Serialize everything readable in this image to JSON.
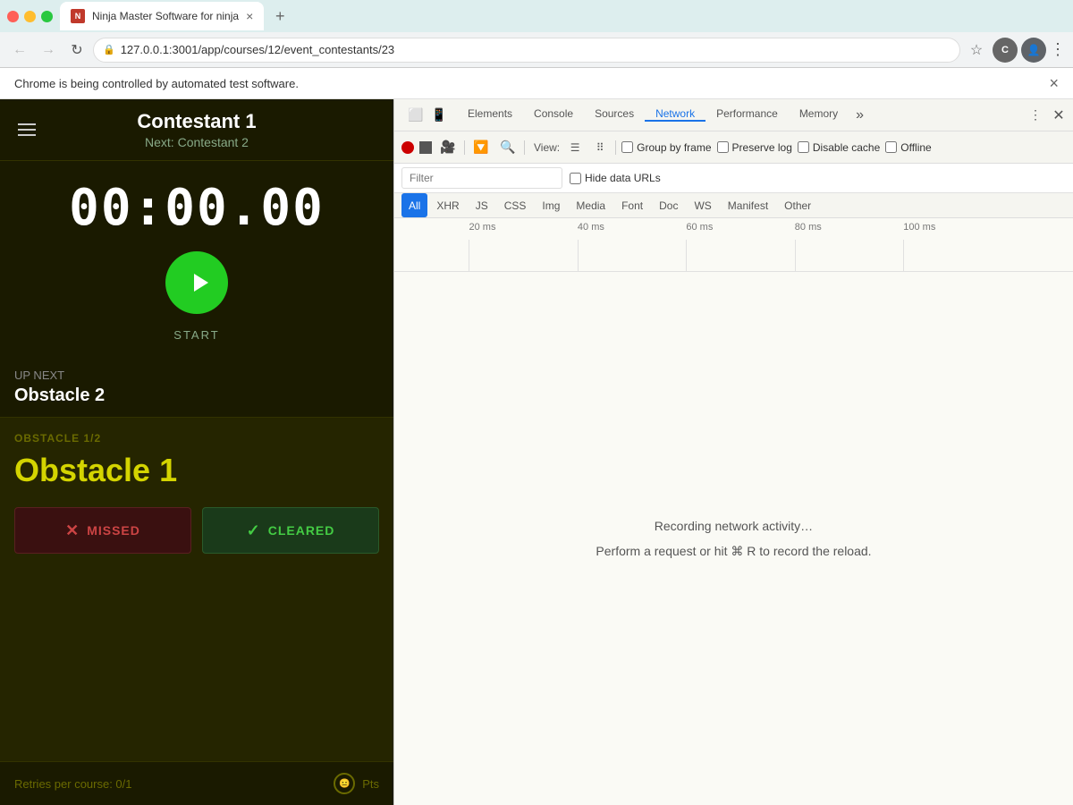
{
  "window": {
    "controls": {
      "close": "×",
      "min": "–",
      "max": "□"
    }
  },
  "tab": {
    "favicon_text": "N",
    "title": "Ninja Master Software for ninja",
    "close_btn": "×"
  },
  "new_tab_btn": "+",
  "address_bar": {
    "url": "127.0.0.1:3001/app/courses/12/event_contestants/23",
    "protocol": "127.0.0.1:",
    "path": "3001/app/courses/12/event_contestants/23"
  },
  "notification": {
    "text": "Chrome is being controlled by automated test software.",
    "close_btn": "×"
  },
  "app": {
    "contestant_name": "Contestant 1",
    "contestant_next": "Next: Contestant 2",
    "timer": "00:00.00",
    "start_label": "START",
    "up_next_label": "UP NEXT",
    "up_next_name": "Obstacle 2",
    "obstacle_label": "OBSTACLE 1/2",
    "obstacle_name": "Obstacle 1",
    "missed_btn": "MISSED",
    "cleared_btn": "CLEARED",
    "retries_label": "Retries per course: 0/1",
    "pts_label": "Pts"
  },
  "devtools": {
    "tabs": [
      {
        "label": "Elements",
        "active": false
      },
      {
        "label": "Console",
        "active": false
      },
      {
        "label": "Sources",
        "active": false
      },
      {
        "label": "Network",
        "active": true
      },
      {
        "label": "Performance",
        "active": false
      },
      {
        "label": "Memory",
        "active": false
      }
    ],
    "more_tabs": "»",
    "network_toolbar": {
      "view_label": "View:",
      "group_by_frame_label": "Group by frame",
      "preserve_log_label": "Preserve log",
      "disable_cache_label": "Disable cache",
      "offline_label": "Offline"
    },
    "filter_placeholder": "Filter",
    "hide_data_urls_label": "Hide data URLs",
    "filter_types": [
      "All",
      "XHR",
      "JS",
      "CSS",
      "Img",
      "Media",
      "Font",
      "Doc",
      "WS",
      "Manifest",
      "Other"
    ],
    "timeline_labels": [
      "20 ms",
      "40 ms",
      "60 ms",
      "80 ms",
      "100 ms"
    ],
    "network_messages": {
      "line1": "Recording network activity…",
      "line2": "Perform a request or hit ⌘ R to record the reload."
    }
  }
}
